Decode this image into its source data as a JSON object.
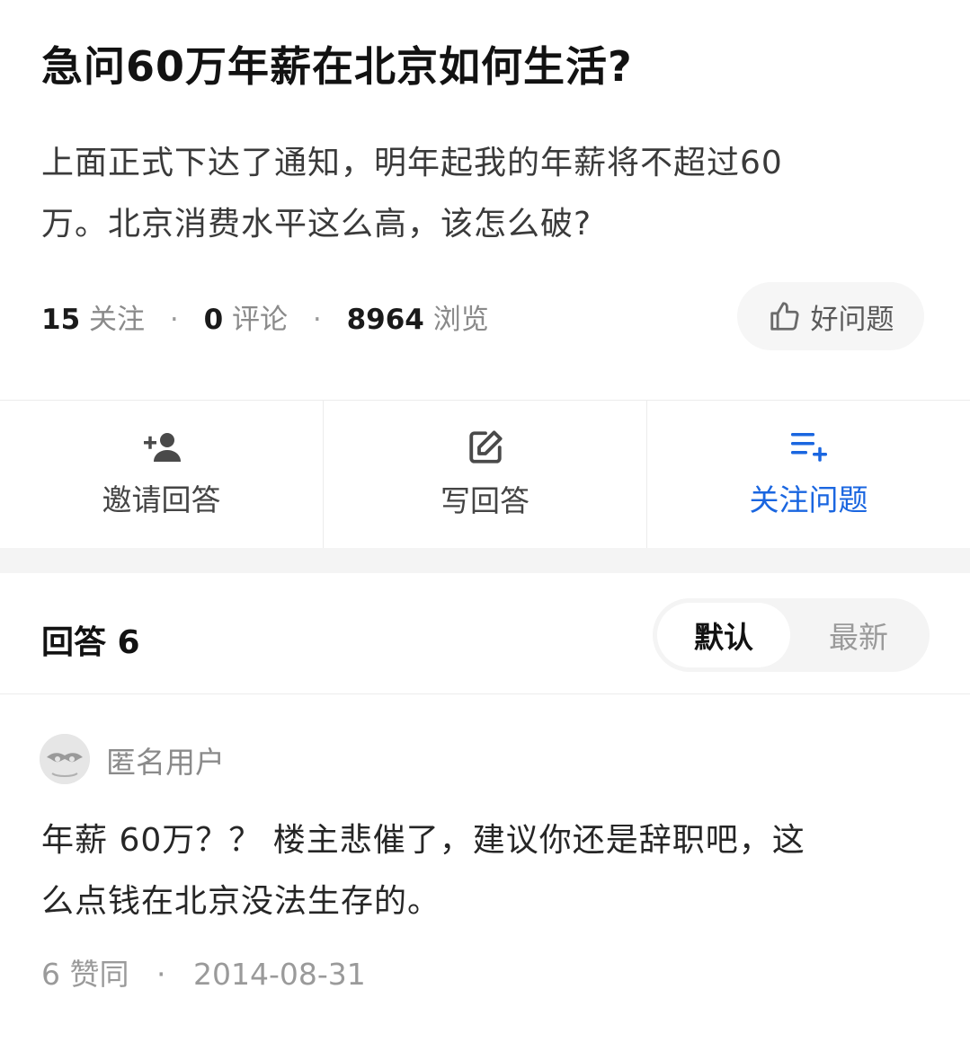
{
  "question": {
    "title": "急问60万年薪在北京如何生活?",
    "body_line1": "上面正式下达了通知，明年起我的年薪将不超过60",
    "body_line2": "万。北京消费水平这么高，该怎么破?",
    "follow_count": "15",
    "follow_label": "关注",
    "comment_count": "0",
    "comment_label": "评论",
    "view_count": "8964",
    "view_label": "浏览",
    "separator": "·",
    "good_question_label": "好问题"
  },
  "actions": [
    {
      "label": "邀请回答",
      "icon": "invite-user-icon"
    },
    {
      "label": "写回答",
      "icon": "edit-icon"
    },
    {
      "label": "关注问题",
      "icon": "follow-list-icon"
    }
  ],
  "answers_header": {
    "title": "回答 6",
    "sort_default": "默认",
    "sort_latest": "最新"
  },
  "answer": {
    "author": "匿名用户",
    "body_line1": "年薪 60万？？ 楼主悲催了，建议你还是辞职吧，这",
    "body_line2": "么点钱在北京没法生存的。",
    "likes": "6 赞同",
    "separator": "·",
    "date": "2014-08-31"
  },
  "colors": {
    "accent_blue": "#1a66e0",
    "muted_text": "#8a8a8a",
    "divider": "#ececec"
  }
}
